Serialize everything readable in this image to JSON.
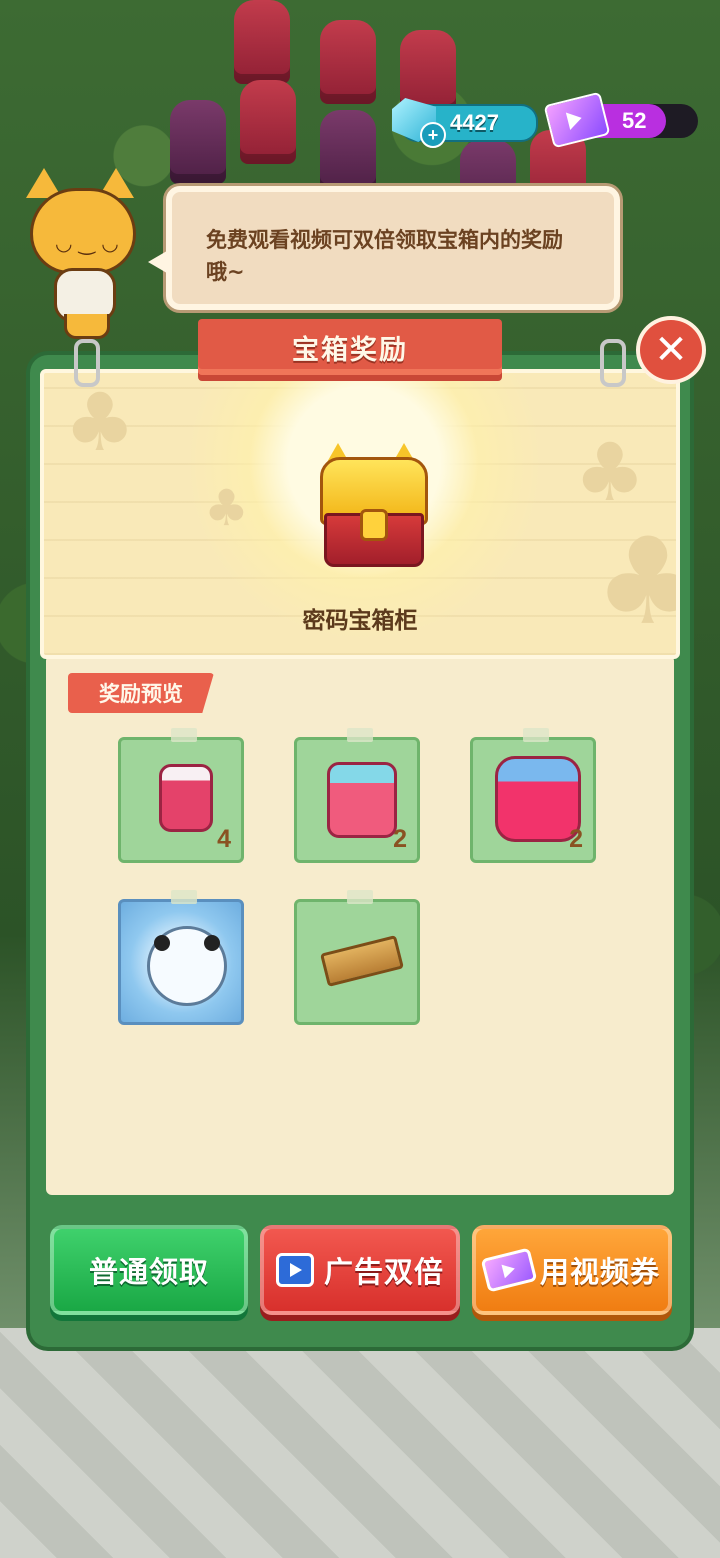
{
  "hud": {
    "gems": "4427",
    "video_tickets": "52"
  },
  "mascot": {
    "speech": "免费观看视频可双倍领取宝箱内的奖励哦~"
  },
  "dialog": {
    "title": "宝箱奖励",
    "close_icon": "✕",
    "chest_name": "密码宝箱柜",
    "preview_label": "奖励预览",
    "rewards": [
      {
        "icon": "small-cherry-jam-jar",
        "qty": "4"
      },
      {
        "icon": "medium-cherry-jam-jar",
        "qty": "2"
      },
      {
        "icon": "large-ribbon-jam-jar",
        "qty": "2"
      },
      {
        "icon": "panda-bun-decoration",
        "qty": ""
      },
      {
        "icon": "wooden-plank",
        "qty": ""
      }
    ]
  },
  "buttons": {
    "normal_claim": "普通领取",
    "ad_double": "广告双倍",
    "use_video_ticket": "用视频券"
  },
  "colors": {
    "panel_green": "#3f8a4d",
    "ribbon_red": "#e15a46",
    "claim_green": "#1aa845",
    "ad_red": "#d8302c",
    "ticket_orange": "#f07d12"
  }
}
